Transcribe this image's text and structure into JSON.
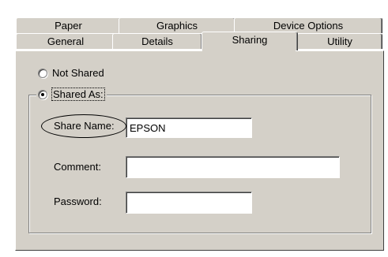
{
  "tabs": {
    "row_back": [
      "Paper",
      "Graphics",
      "Device Options"
    ],
    "row_front": [
      "General",
      "Details",
      "Sharing",
      "Utility"
    ],
    "active": "Sharing"
  },
  "sharing": {
    "not_shared_label": "Not Shared",
    "not_shared_checked": false,
    "shared_as_label": "Shared As:",
    "shared_as_checked": true,
    "share_name_label": "Share Name:",
    "share_name_value": "EPSON",
    "comment_label": "Comment:",
    "comment_value": "",
    "password_label": "Password:",
    "password_value": ""
  },
  "colors": {
    "face": "#d4d0c8",
    "highlight": "#ffffff",
    "shadow": "#808080"
  }
}
